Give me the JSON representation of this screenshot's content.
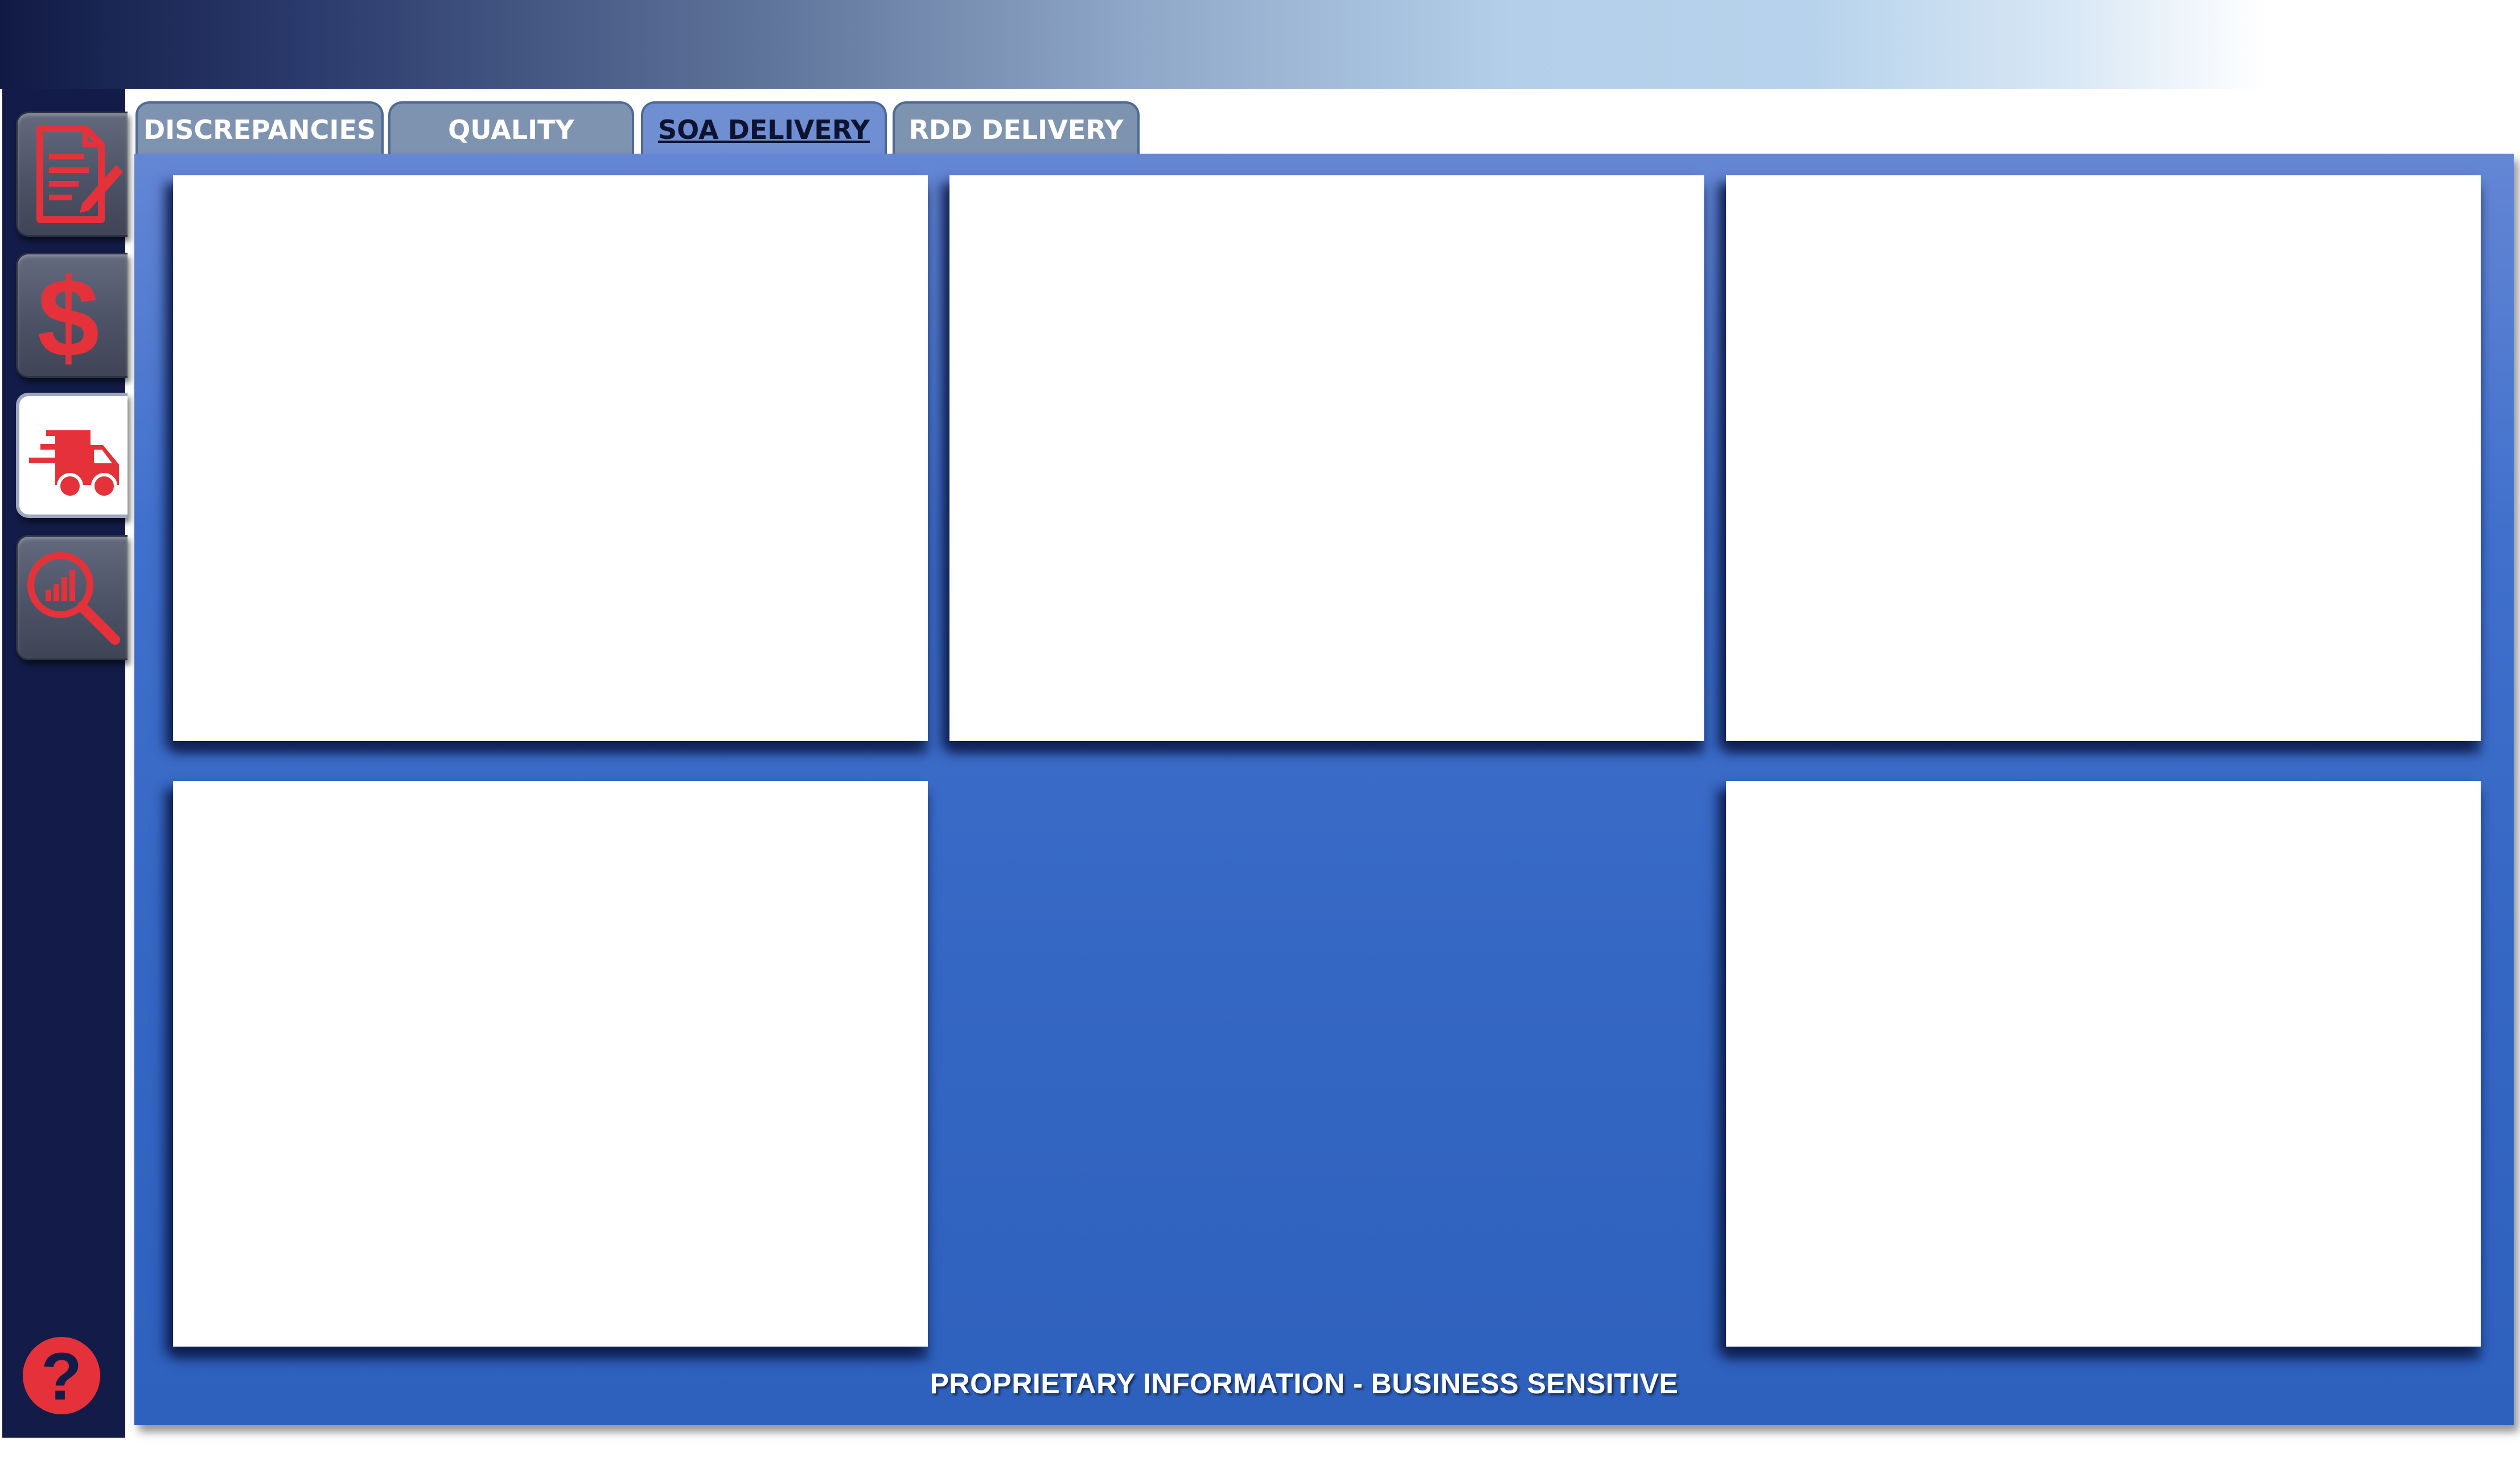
{
  "tabs": [
    {
      "label": "DISCREPANCIES",
      "active": false
    },
    {
      "label": "QUALITY",
      "active": false
    },
    {
      "label": "SOA DELIVERY",
      "active": true
    },
    {
      "label": "RDD DELIVERY",
      "active": false
    }
  ],
  "sidebar": {
    "items": [
      {
        "icon": "document-edit-icon",
        "active": false
      },
      {
        "icon": "dollar-icon",
        "active": false
      },
      {
        "icon": "delivery-truck-icon",
        "active": true
      },
      {
        "icon": "analytics-search-icon",
        "active": false
      }
    ],
    "help_icon": "help-icon",
    "help_glyph": "?"
  },
  "footer": {
    "text": "PROPRIETARY INFORMATION - BUSINESS SENSITIVE"
  },
  "colors": {
    "accent": "#e5323a",
    "sidebar": "#131c48",
    "panel": "#3a6bc8"
  }
}
